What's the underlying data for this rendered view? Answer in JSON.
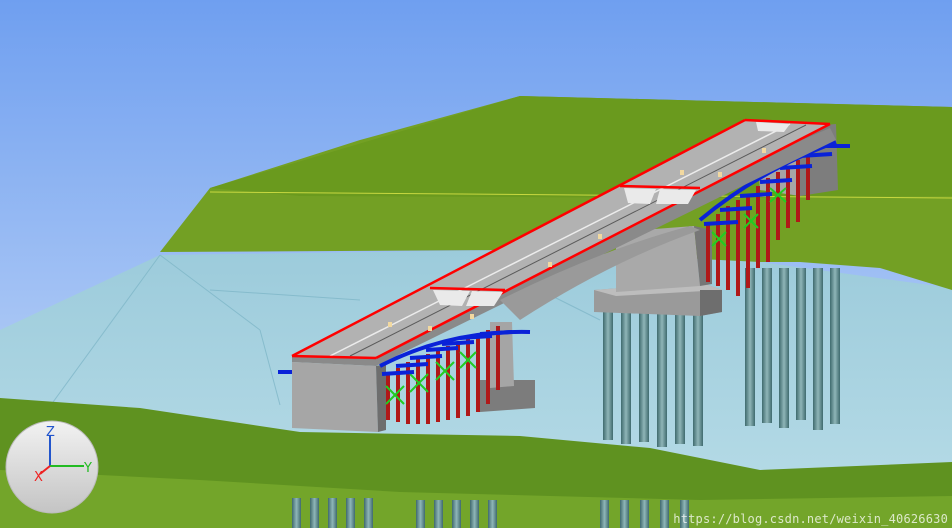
{
  "viewport": {
    "name": "3D bridge model viewport",
    "sky_top_color": "#6f9ff0",
    "sky_bottom_color": "#c9dcf7",
    "water_color": "#8fc4d6",
    "ground_color": "#6a9a24",
    "deck_color": "#a8a8a8",
    "edge_highlight_color": "#ff0000",
    "support_color": "#b01818",
    "bracing_color": "#0a22d8",
    "tie_color": "#22cc22",
    "pile_color": "#5e8a8e"
  },
  "axis_gizmo": {
    "z_label": "Z",
    "x_label": "X",
    "y_label": "Y",
    "z_color": "#2255cc",
    "x_color": "#ee2222",
    "y_color": "#22bb22"
  },
  "watermark": "https://blog.csdn.net/weixin_40626630"
}
